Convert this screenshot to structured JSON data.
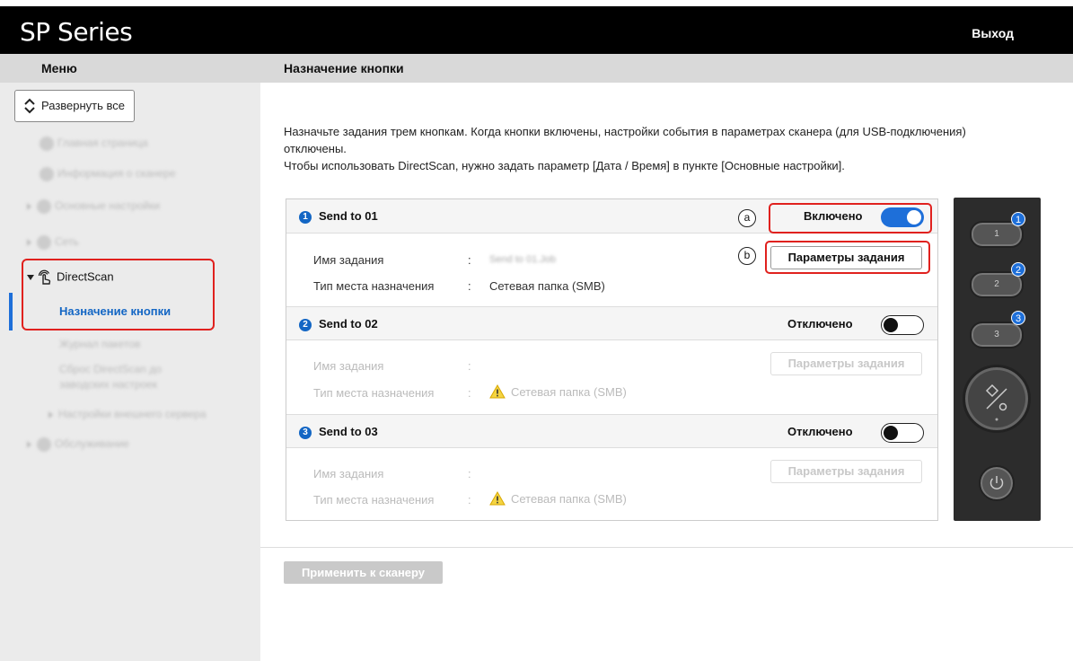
{
  "app": {
    "brand": "SP Series",
    "logout_label": "Выход"
  },
  "header": {
    "menu_title": "Меню",
    "page_title": "Назначение кнопки"
  },
  "sidebar": {
    "expand_label": "Развернуть все",
    "items": [
      {
        "label": "Главная страница",
        "icon": "home-icon"
      },
      {
        "label": "Информация о сканере",
        "icon": "info-icon"
      },
      {
        "label": "Основные настройки",
        "icon": "gear-icon"
      },
      {
        "label": "Сеть",
        "icon": "network-icon"
      },
      {
        "label": "DirectScan",
        "icon": "touch-hand-icon"
      },
      {
        "label": "Назначение кнопки",
        "active": true
      },
      {
        "label": "Журнал пакетов"
      },
      {
        "label": "Сброс DirectScan до заводских настроек"
      },
      {
        "label": "Настройки внешнего сервера"
      },
      {
        "label": "Обслуживание",
        "icon": "wrench-icon"
      }
    ]
  },
  "main": {
    "description_line1": "Назначьте задания трем кнопкам. Когда кнопки включены, настройки события в параметрах сканера (для USB-подключения) отключены.",
    "description_line2": "Чтобы использовать DirectScan, нужно задать параметр [Дата / Время] в пункте [Основные настройки].",
    "sections": [
      {
        "number": "1",
        "title": "Send to 01",
        "state": "Включено",
        "enabled": true,
        "job_name_label": "Имя задания",
        "job_name_value": "Send to 01.Job",
        "dest_label": "Тип места назначения",
        "dest_value": "Сетевая папка (SMB)",
        "params_button": "Параметры задания"
      },
      {
        "number": "2",
        "title": "Send to 02",
        "state": "Отключено",
        "enabled": false,
        "job_name_label": "Имя задания",
        "job_name_value": "",
        "dest_label": "Тип места назначения",
        "dest_value": "Сетевая папка (SMB)",
        "params_button": "Параметры задания"
      },
      {
        "number": "3",
        "title": "Send to 03",
        "state": "Отключено",
        "enabled": false,
        "job_name_label": "Имя задания",
        "job_name_value": "",
        "dest_label": "Тип места назначения",
        "dest_value": "Сетевая папка (SMB)",
        "params_button": "Параметры задания"
      }
    ],
    "colon": ":",
    "callouts": {
      "a": "a",
      "b": "b"
    },
    "apply_button": "Применить к сканеру"
  },
  "scanner_panel": {
    "buttons": [
      {
        "label": "1",
        "badge": "1"
      },
      {
        "label": "2",
        "badge": "2"
      },
      {
        "label": "3",
        "badge": "3"
      }
    ]
  },
  "colors": {
    "accent": "#1e6fd9",
    "highlight": "#e0211e",
    "topbar": "#000000"
  }
}
